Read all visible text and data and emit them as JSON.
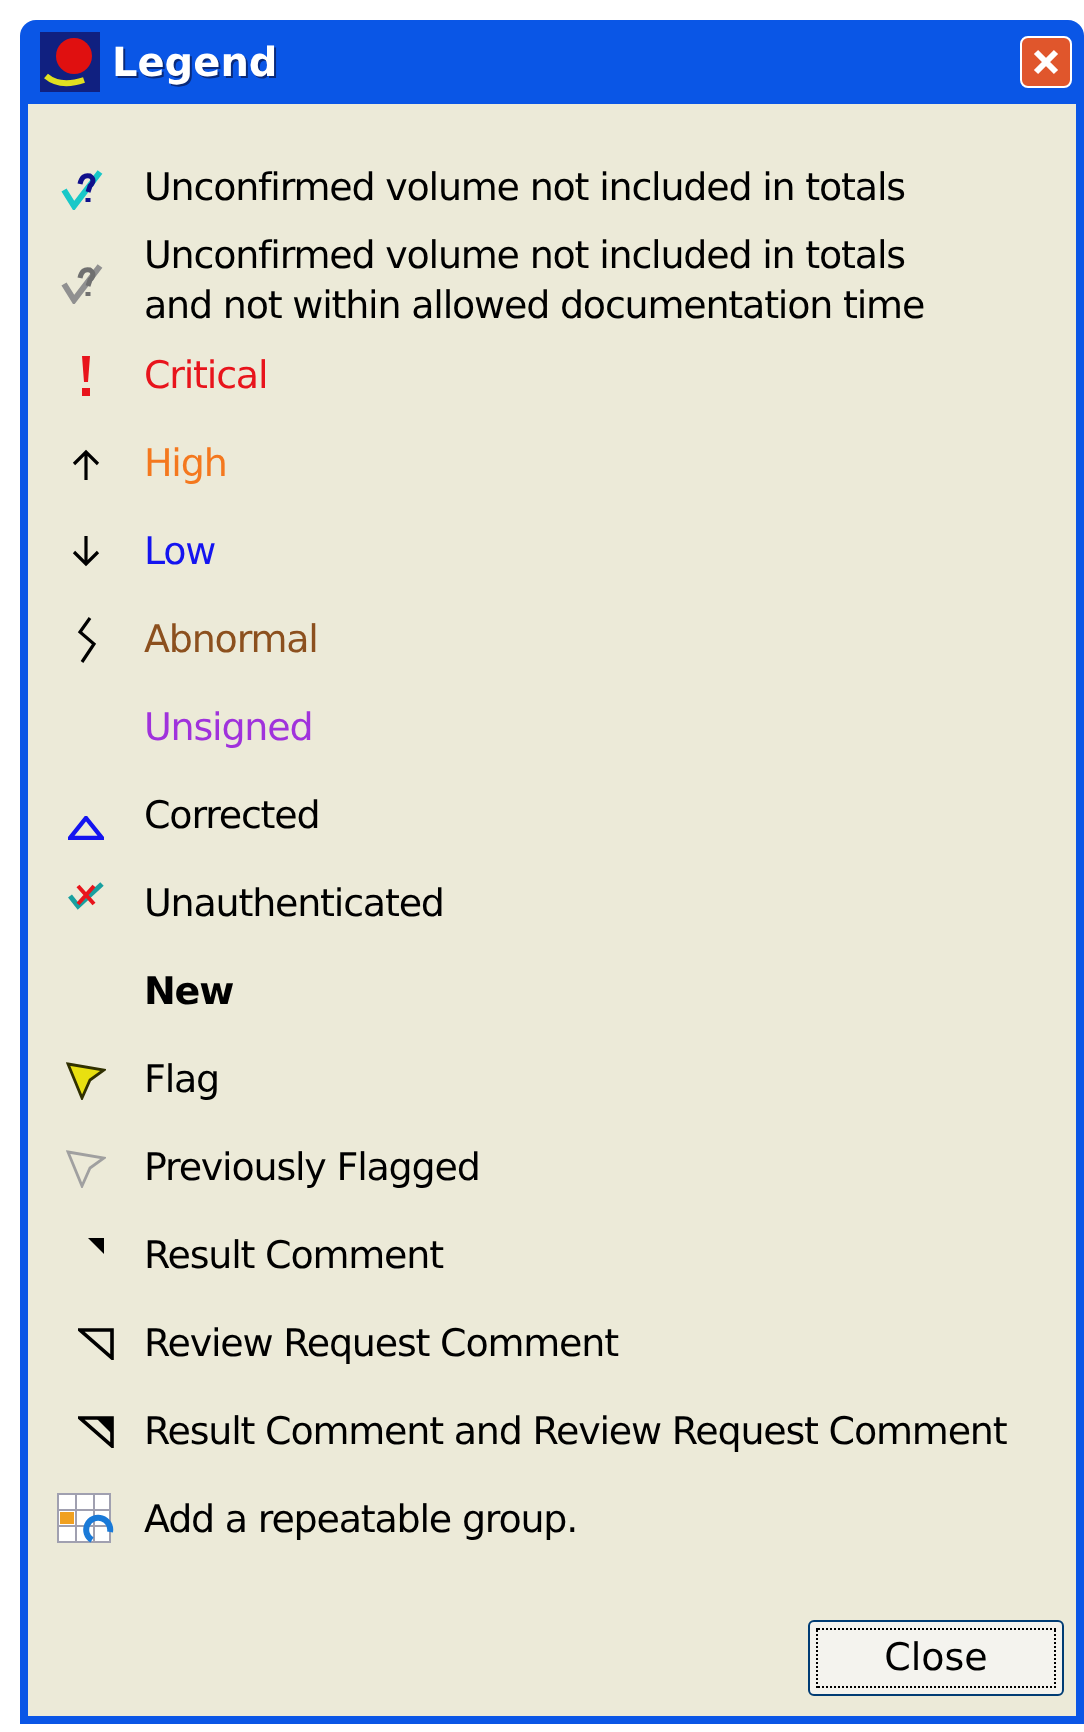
{
  "window": {
    "title": "Legend"
  },
  "items": [
    {
      "kind": "unconfirmed",
      "label": "Unconfirmed volume not included in totals",
      "color": "#000000",
      "bold": false
    },
    {
      "kind": "expired",
      "label": "Unconfirmed volume not included in totals\nand not within allowed documentation time",
      "color": "#000000",
      "bold": false
    },
    {
      "kind": "exclamation",
      "label": "Critical",
      "color": "#e8141c",
      "bold": false
    },
    {
      "kind": "up",
      "label": "High",
      "color": "#f4781e",
      "bold": false
    },
    {
      "kind": "down",
      "label": "Low",
      "color": "#1414f0",
      "bold": false
    },
    {
      "kind": "zigzag",
      "label": "Abnormal",
      "color": "#8c501e",
      "bold": false
    },
    {
      "kind": "plain",
      "label": "Unsigned",
      "color": "#a032dc",
      "bold": false
    },
    {
      "kind": "triangle",
      "label": "Corrected",
      "color": "#000000",
      "bold": false
    },
    {
      "kind": "crosscheck",
      "label": "Unauthenticated",
      "color": "#000000",
      "bold": false
    },
    {
      "kind": "plain",
      "label": "New",
      "color": "#000000",
      "bold": true
    },
    {
      "kind": "flag",
      "label": "Flag",
      "color": "#000000",
      "bold": false
    },
    {
      "kind": "flagged",
      "label": "Previously Flagged",
      "color": "#000000",
      "bold": false
    },
    {
      "kind": "result",
      "label": "Result Comment",
      "color": "#000000",
      "bold": false
    },
    {
      "kind": "review",
      "label": "Review Request Comment",
      "color": "#000000",
      "bold": false
    },
    {
      "kind": "both",
      "label": "Result Comment and Review Request Comment",
      "color": "#000000",
      "bold": false
    },
    {
      "kind": "group",
      "label": "Add a repeatable group.",
      "color": "#000000",
      "bold": false
    }
  ],
  "buttons": [
    {
      "label": "Close"
    }
  ]
}
